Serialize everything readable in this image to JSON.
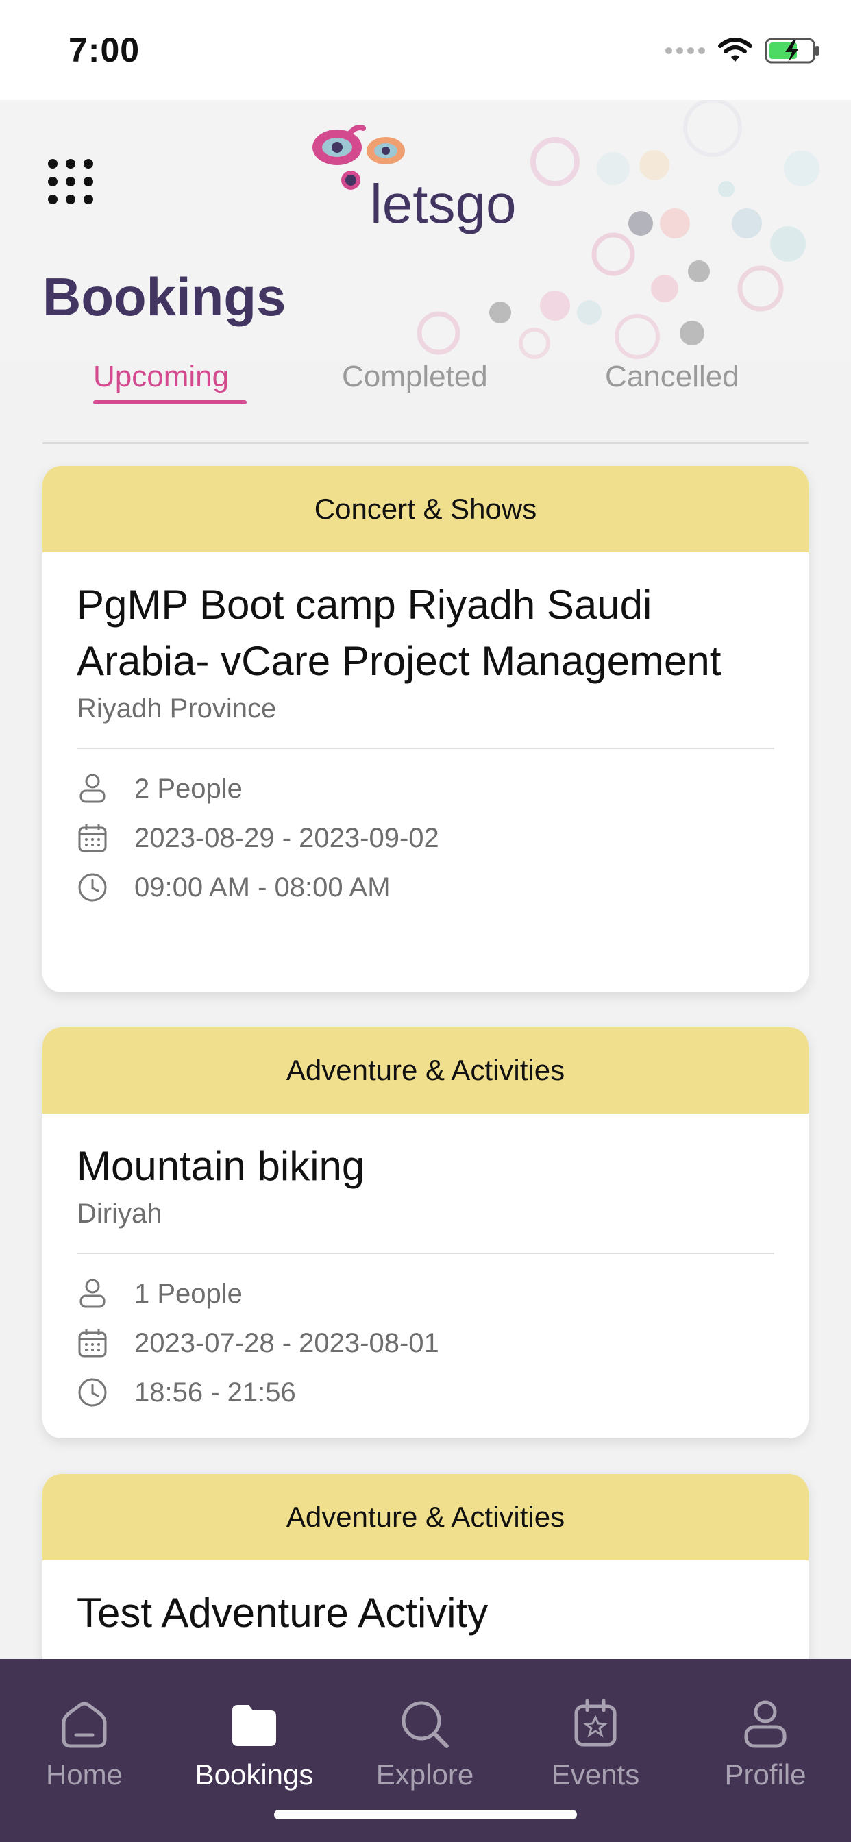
{
  "status_bar": {
    "time": "7:00"
  },
  "app": {
    "logo_text": "letsgo",
    "page_title": "Bookings"
  },
  "tabs": [
    {
      "label": "Upcoming",
      "active": true
    },
    {
      "label": "Completed",
      "active": false
    },
    {
      "label": "Cancelled",
      "active": false
    }
  ],
  "bookings": [
    {
      "category": "Concert & Shows",
      "title": "PgMP Boot camp Riyadh Saudi Arabia- vCare Project Management",
      "location": "Riyadh Province",
      "people": "2 People",
      "dates": "2023-08-29 - 2023-09-02",
      "time": "09:00 AM - 08:00 AM"
    },
    {
      "category": "Adventure & Activities",
      "title": "Mountain biking",
      "location": "Diriyah",
      "people": "1 People",
      "dates": "2023-07-28 - 2023-08-01",
      "time": "18:56 - 21:56"
    },
    {
      "category": "Adventure & Activities",
      "title": "Test Adventure Activity"
    }
  ],
  "nav": [
    {
      "label": "Home",
      "icon": "home-icon",
      "active": false
    },
    {
      "label": "Bookings",
      "icon": "folder-icon",
      "active": true
    },
    {
      "label": "Explore",
      "icon": "search-icon",
      "active": false
    },
    {
      "label": "Events",
      "icon": "calendar-star-icon",
      "active": false
    },
    {
      "label": "Profile",
      "icon": "user-icon",
      "active": false
    }
  ],
  "colors": {
    "brand": "#433562",
    "accent": "#d34a8f",
    "category_bg": "#f0df8c",
    "nav_bg": "#433453"
  }
}
